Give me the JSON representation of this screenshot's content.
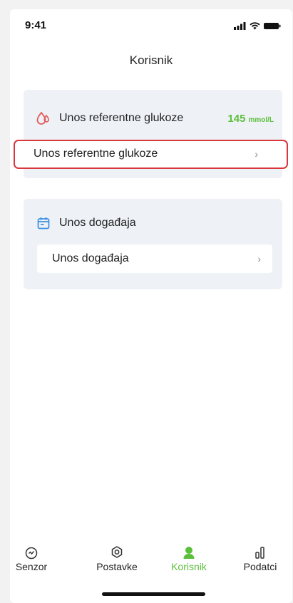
{
  "status_bar": {
    "time": "9:41"
  },
  "header": {
    "title": "Korisnik"
  },
  "glucose_card": {
    "title": "Unos referentne glukoze",
    "value": "145",
    "unit": "mmol/L",
    "row_label": "Unos referentne glukoze",
    "icon": "blood-drop-icon",
    "accent_color": "#5cbf3c"
  },
  "event_card": {
    "title": "Unos događaja",
    "row_label": "Unos događaja",
    "icon": "calendar-icon"
  },
  "tabs": [
    {
      "label": "Senzor",
      "icon": "sensor-icon",
      "active": false
    },
    {
      "label": "Postavke",
      "icon": "settings-icon",
      "active": false
    },
    {
      "label": "Korisnik",
      "icon": "user-icon",
      "active": true
    },
    {
      "label": "Podatci",
      "icon": "bar-chart-icon",
      "active": false
    }
  ],
  "colors": {
    "active": "#5cbf3c",
    "highlight": "#d9363e",
    "card_bg": "#eef1f6"
  }
}
